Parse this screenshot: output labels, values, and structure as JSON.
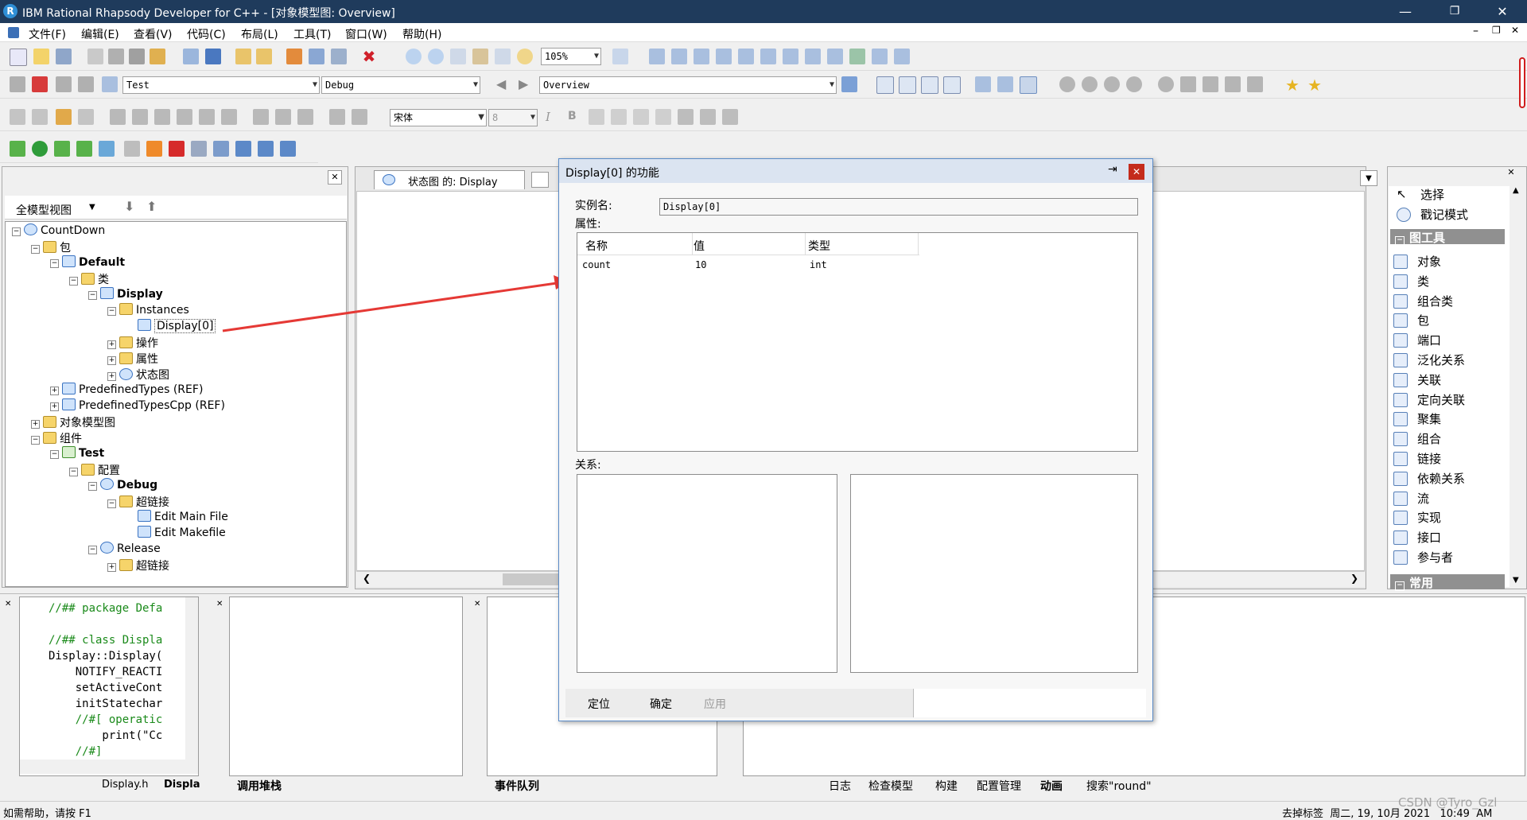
{
  "window": {
    "title": "IBM Rational Rhapsody Developer for C++ - [对象模型图: Overview]",
    "app_icon": "R",
    "minimize": "—",
    "restore": "❐",
    "close": "✕"
  },
  "menu": {
    "items": [
      "文件(F)",
      "编辑(E)",
      "查看(V)",
      "代码(C)",
      "布局(L)",
      "工具(T)",
      "窗口(W)",
      "帮助(H)"
    ],
    "mdi_min": "–",
    "mdi_restore": "❐",
    "mdi_close": "✕"
  },
  "toolbar": {
    "zoom": "105%",
    "component": "Test",
    "configuration": "Debug",
    "diagram": "Overview",
    "font": "宋体",
    "font_size": "8",
    "bold": "B",
    "italic": "I"
  },
  "browser": {
    "view": "全模型视图",
    "tree": [
      {
        "label": "CountDown",
        "bold": false
      },
      {
        "label": "包",
        "bold": false
      },
      {
        "label": "Default",
        "bold": true
      },
      {
        "label": "类",
        "bold": false
      },
      {
        "label": "Display",
        "bold": true
      },
      {
        "label": "Instances",
        "bold": false
      },
      {
        "label": "Display[0]",
        "bold": false
      },
      {
        "label": "操作",
        "bold": false
      },
      {
        "label": "属性",
        "bold": false
      },
      {
        "label": "状态图",
        "bold": false
      },
      {
        "label": "PredefinedTypes (REF)",
        "bold": false
      },
      {
        "label": "PredefinedTypesCpp (REF)",
        "bold": false
      },
      {
        "label": "对象模型图",
        "bold": false
      },
      {
        "label": "组件",
        "bold": false
      },
      {
        "label": "Test",
        "bold": true
      },
      {
        "label": "配置",
        "bold": false
      },
      {
        "label": "Debug",
        "bold": true
      },
      {
        "label": "超链接",
        "bold": false
      },
      {
        "label": "Edit Main File",
        "bold": false
      },
      {
        "label": "Edit Makefile",
        "bold": false
      },
      {
        "label": "Release",
        "bold": false
      },
      {
        "label": "超链接",
        "bold": false
      }
    ]
  },
  "diagram_tab": {
    "label": "状态图 的: Display"
  },
  "dialog": {
    "title": "Display[0] 的功能",
    "pin": "⇥",
    "close": "✕",
    "instance_label": "实例名:",
    "instance_value": "Display[0]",
    "attributes_label": "属性:",
    "columns": [
      "名称",
      "值",
      "类型"
    ],
    "rows": [
      {
        "name": "count",
        "value": "10",
        "type": "int"
      }
    ],
    "relations_label": "关系:",
    "buttons": {
      "locate": "定位",
      "ok": "确定",
      "apply": "应用"
    }
  },
  "palette": {
    "select": "选择",
    "stamp": "戳记模式",
    "header_tools": "图工具",
    "items": [
      "对象",
      "类",
      "组合类",
      "包",
      "端口",
      "泛化关系",
      "关联",
      "定向关联",
      "聚集",
      "组合",
      "链接",
      "依赖关系",
      "流",
      "实现",
      "接口",
      "参与者"
    ],
    "header_common": "常用"
  },
  "code": {
    "lines": [
      "//## package Defa",
      "",
      "//## class Displa",
      "Display::Display(",
      "    NOTIFY_REACTI",
      "    setActiveCont",
      "    initStatechar",
      "    //#[ operatic",
      "        print(\"Cc",
      "    //#]"
    ],
    "tabs": [
      "Display.h",
      "Displa"
    ]
  },
  "bottom_tabs": {
    "call_stack": "调用堆栈",
    "event_queue": "事件队列",
    "output": [
      "日志",
      "检查模型",
      "构建",
      "配置管理",
      "动画",
      "搜索\"round\""
    ]
  },
  "status": {
    "help": "如需帮助，请按 F1",
    "right": "去掉标签  周二, 19, 10月 2021   10:49  AM",
    "watermark": "CSDN @Tyro_Gzl"
  },
  "colors": {
    "titlebar": "#1f3b5c",
    "arrow": "#e53935",
    "palette_header": "#909090",
    "dialog_border": "#5a8bc7"
  }
}
